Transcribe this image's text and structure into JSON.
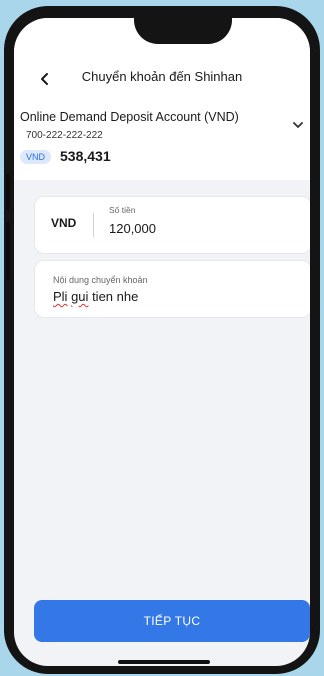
{
  "header": {
    "title": "Chuyển khoản đến Shinhan",
    "back_icon": "chevron-left-icon"
  },
  "account": {
    "name": "Online Demand Deposit Account (VND)",
    "number": "700-222-222-222",
    "currency_badge": "VND",
    "balance": "538,431",
    "expand_icon": "chevron-down-icon"
  },
  "amount": {
    "currency": "VND",
    "label": "Số tiền",
    "value": "120,000"
  },
  "description": {
    "label": "Nội dung chuyển khoản",
    "value_word1": "Pli",
    "value_word2": "gui",
    "value_rest": "tien nhe"
  },
  "continue_button": {
    "label": "TIẾP TỤC"
  },
  "colors": {
    "accent": "#3478e8",
    "background": "#a9d6ea",
    "screen": "#f1f3f6"
  }
}
